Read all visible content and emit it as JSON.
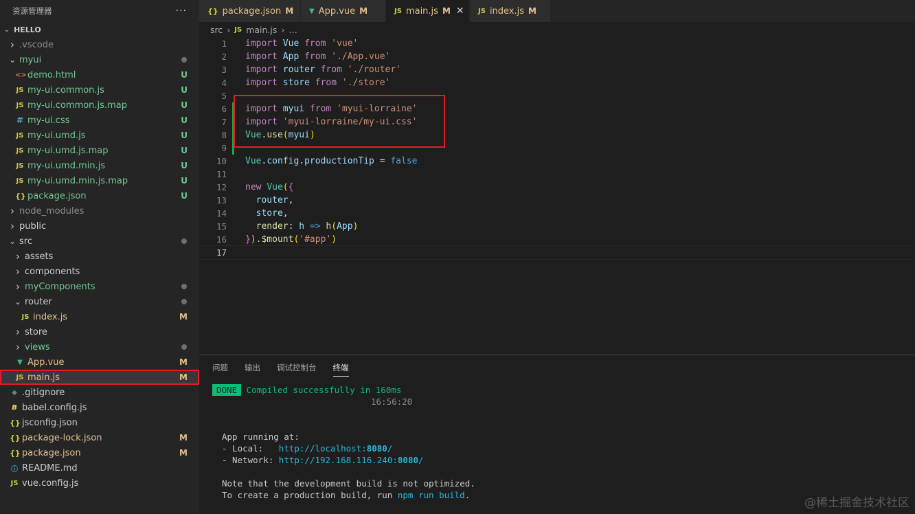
{
  "sidebar": {
    "title": "资源管理器",
    "more": "···",
    "root": "HELLO",
    "items": [
      {
        "label": ".vscode",
        "icon": "chevron-right",
        "status": ""
      },
      {
        "label": "myui",
        "icon": "chevron-down",
        "status": "dot"
      },
      {
        "label": "demo.html",
        "icon": "html",
        "status": "U"
      },
      {
        "label": "my-ui.common.js",
        "icon": "js",
        "status": "U"
      },
      {
        "label": "my-ui.common.js.map",
        "icon": "js",
        "status": "U"
      },
      {
        "label": "my-ui.css",
        "icon": "css",
        "status": "U"
      },
      {
        "label": "my-ui.umd.js",
        "icon": "js",
        "status": "U"
      },
      {
        "label": "my-ui.umd.js.map",
        "icon": "js",
        "status": "U"
      },
      {
        "label": "my-ui.umd.min.js",
        "icon": "js",
        "status": "U"
      },
      {
        "label": "my-ui.umd.min.js.map",
        "icon": "js",
        "status": "U"
      },
      {
        "label": "package.json",
        "icon": "json",
        "status": "U"
      },
      {
        "label": "node_modules",
        "icon": "chevron-right",
        "status": ""
      },
      {
        "label": "public",
        "icon": "chevron-right",
        "status": ""
      },
      {
        "label": "src",
        "icon": "chevron-down",
        "status": "dot"
      },
      {
        "label": "assets",
        "icon": "chevron-right",
        "status": ""
      },
      {
        "label": "components",
        "icon": "chevron-right",
        "status": ""
      },
      {
        "label": "myComponents",
        "icon": "chevron-right",
        "status": "dot"
      },
      {
        "label": "router",
        "icon": "chevron-down",
        "status": "dot"
      },
      {
        "label": "index.js",
        "icon": "js",
        "status": "M"
      },
      {
        "label": "store",
        "icon": "chevron-right",
        "status": ""
      },
      {
        "label": "views",
        "icon": "chevron-right",
        "status": "dot"
      },
      {
        "label": "App.vue",
        "icon": "vue",
        "status": "M"
      },
      {
        "label": "main.js",
        "icon": "js",
        "status": "M"
      },
      {
        "label": ".gitignore",
        "icon": "git",
        "status": ""
      },
      {
        "label": "babel.config.js",
        "icon": "babel",
        "status": ""
      },
      {
        "label": "jsconfig.json",
        "icon": "json",
        "status": ""
      },
      {
        "label": "package-lock.json",
        "icon": "json",
        "status": "M"
      },
      {
        "label": "package.json",
        "icon": "json",
        "status": "M"
      },
      {
        "label": "README.md",
        "icon": "info",
        "status": ""
      },
      {
        "label": "vue.config.js",
        "icon": "js",
        "status": ""
      }
    ]
  },
  "tabs": [
    {
      "label": "package.json",
      "icon": "{}",
      "status": "M",
      "active": false
    },
    {
      "label": "App.vue",
      "icon": "V",
      "status": "M",
      "active": false
    },
    {
      "label": "main.js",
      "icon": "JS",
      "status": "M",
      "active": true,
      "close": "✕"
    },
    {
      "label": "index.js",
      "icon": "JS",
      "status": "M",
      "active": false
    }
  ],
  "breadcrumb": {
    "folder": "src",
    "sep": "›",
    "icon": "JS",
    "file": "main.js",
    "rest": "…"
  },
  "editor": {
    "line_numbers": [
      "1",
      "2",
      "3",
      "4",
      "5",
      "6",
      "7",
      "8",
      "9",
      "10",
      "11",
      "12",
      "13",
      "14",
      "15",
      "16",
      "17"
    ]
  },
  "panel": {
    "tabs": [
      "问题",
      "输出",
      "调试控制台",
      "终端"
    ],
    "active_tab": "终端",
    "terminal": {
      "done": "DONE",
      "compiled": "Compiled successfully in 160ms",
      "time": "16:56:20",
      "running": "App running at:",
      "local_label": "- Local:   ",
      "local_url": "http://localhost:",
      "local_port": "8080",
      "local_slash": "/",
      "network_label": "- Network: ",
      "network_url": "http://192.168.116.240:",
      "network_port": "8080",
      "network_slash": "/",
      "note1": "Note that the development build is not optimized.",
      "note2_a": "To create a production build, run ",
      "note2_cmd": "npm run build",
      "note2_b": "."
    }
  },
  "watermark": "@稀土掘金技术社区"
}
